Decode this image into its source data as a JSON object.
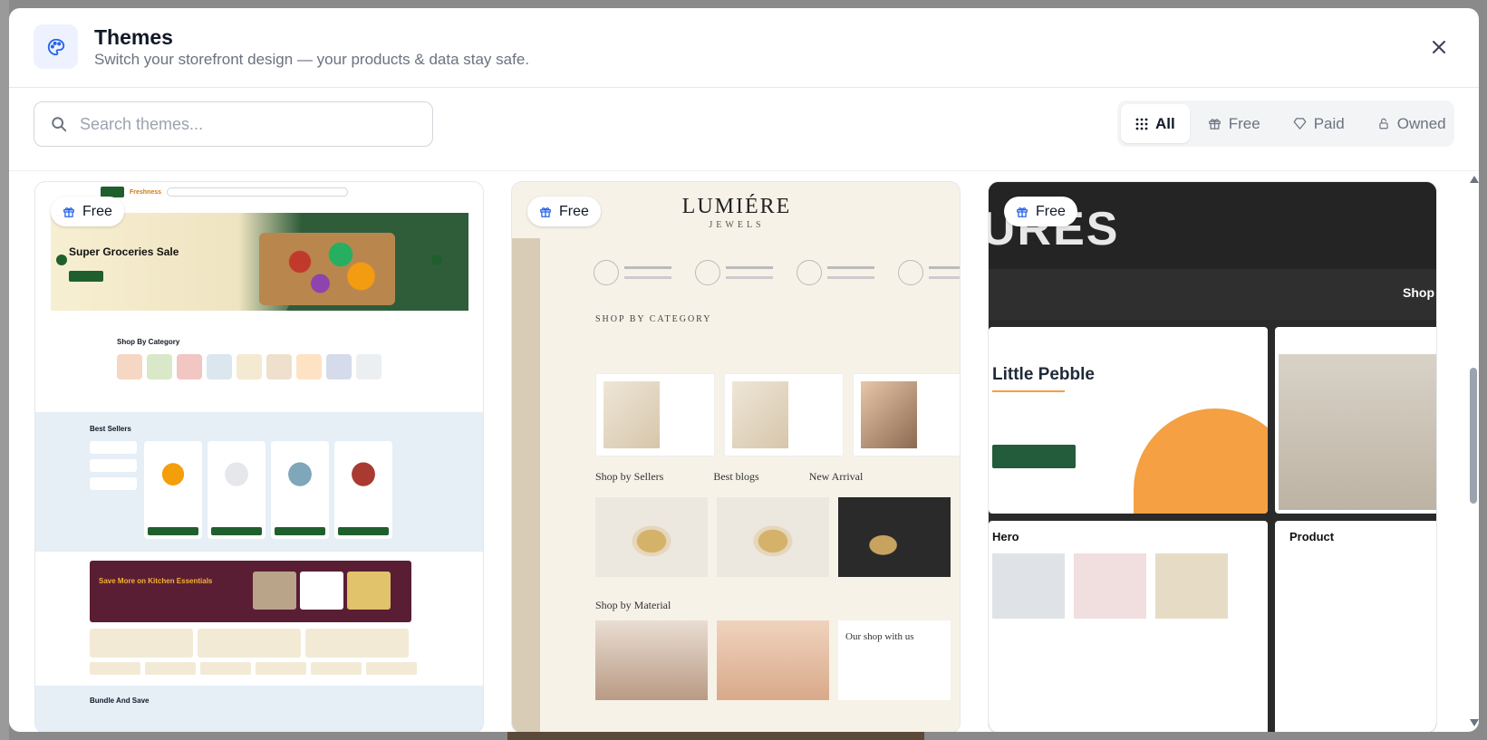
{
  "header": {
    "title": "Themes",
    "subtitle": "Switch your storefront design — your products & data stay safe."
  },
  "search": {
    "placeholder": "Search themes..."
  },
  "filters": [
    {
      "label": "All",
      "icon": "grid-icon",
      "active": true
    },
    {
      "label": "Free",
      "icon": "gift-icon",
      "active": false
    },
    {
      "label": "Paid",
      "icon": "diamond-icon",
      "active": false
    },
    {
      "label": "Owned",
      "icon": "lock-icon",
      "active": false
    }
  ],
  "themes": [
    {
      "badge": "Free",
      "preview": {
        "brand": "Freshness",
        "hero_title": "Super Groceries Sale",
        "section_category": "Shop By Category",
        "section_best": "Best Sellers",
        "promo_title": "Save More on Kitchen Essentials",
        "section_bundle": "Bundle And Save"
      }
    },
    {
      "badge": "Free",
      "preview": {
        "logo": "LUMIÉRE",
        "logo_sub": "JEWELS",
        "section_category": "SHOP BY CATEGORY",
        "row_labels": [
          "Shop by Sellers",
          "Best blogs",
          "New Arrival"
        ],
        "section_material": "Shop by Material",
        "why_title": "Our shop with us"
      }
    },
    {
      "badge": "Free",
      "preview": {
        "big_text": "URES",
        "nav_link": "Shop",
        "hero_title": "Little Pebble",
        "panel_title": "Hero",
        "panel2_title": "Product"
      }
    }
  ],
  "colors": {
    "accent": "#2563eb",
    "header_icon_bg": "#eef2ff"
  }
}
